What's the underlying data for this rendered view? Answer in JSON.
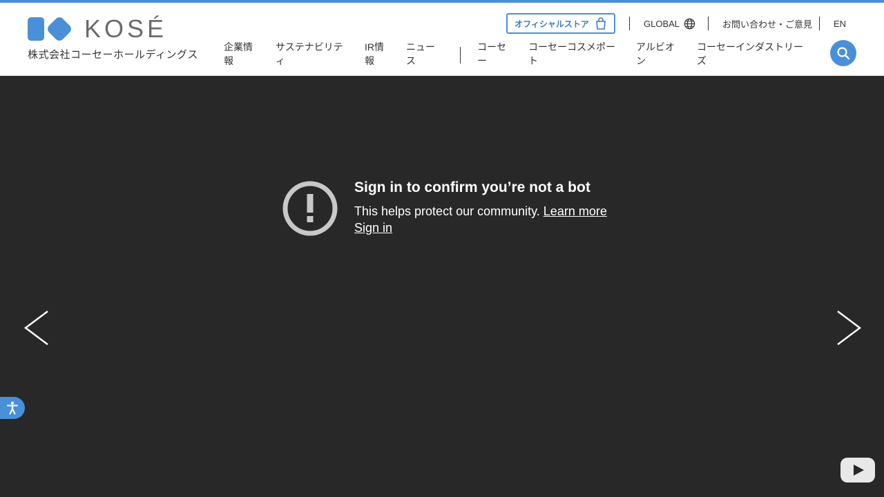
{
  "brand": {
    "logo_text": "KOSÉ",
    "company_name": "株式会社コーセーホールディングス",
    "accent_color": "#4a90d9"
  },
  "utility": {
    "store_label": "オフィシャルストア",
    "store_icon": "shopping-bag-icon",
    "global_label": "GLOBAL",
    "global_icon": "globe-icon",
    "contact_label": "お問い合わせ・ご意見",
    "lang_label": "EN"
  },
  "nav": [
    {
      "line1": "企業情",
      "line2": "報"
    },
    {
      "line1": "サステナビリテ",
      "line2": "ィ"
    },
    {
      "line1": "IR情",
      "line2": "報"
    },
    {
      "line1": "ニュー",
      "line2": "ス"
    },
    {
      "line1": "コーセ",
      "line2": "ー"
    },
    {
      "line1": "コーセーコスメポー",
      "line2": "ト"
    },
    {
      "line1": "アルビオ",
      "line2": "ン"
    },
    {
      "line1": "コーセーインダストリー",
      "line2": "ズ"
    }
  ],
  "search": {
    "icon": "search-icon"
  },
  "video": {
    "background": "#282828",
    "message_title": "Sign in to confirm you’re not a bot",
    "message_body": "This helps protect our community.",
    "learn_more": "Learn more",
    "sign_in": "Sign in",
    "warning_icon": "exclamation-circle-icon",
    "prev_icon": "chevron-left-icon",
    "next_icon": "chevron-right-icon",
    "platform_icon": "youtube-logo-icon"
  },
  "accessibility": {
    "icon": "accessibility-icon"
  }
}
